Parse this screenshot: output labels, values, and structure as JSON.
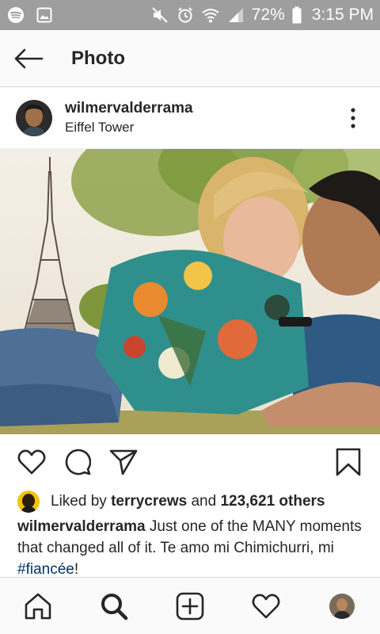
{
  "status_bar": {
    "battery_percent": "72%",
    "time": "3:15 PM",
    "icons": [
      "spotify-icon",
      "gallery-icon",
      "mute-icon",
      "alarm-icon",
      "wifi-icon",
      "signal-icon",
      "battery-icon"
    ]
  },
  "header": {
    "title": "Photo",
    "back_icon": "arrow-left-icon"
  },
  "post": {
    "username": "wilmervalderrama",
    "location": "Eiffel Tower",
    "more_icon": "more-vertical-icon"
  },
  "actions": {
    "icons": [
      "heart-icon",
      "comment-icon",
      "share-icon",
      "bookmark-icon"
    ]
  },
  "likes": {
    "prefix": "Liked by",
    "liker": "terrycrews",
    "joiner": "and",
    "others": "123,621 others"
  },
  "caption": {
    "username": "wilmervalderrama",
    "text": "Just one of the MANY moments that changed all of it.  Te amo mi Chimichurri, mi",
    "hashtag": "#fiancée",
    "suffix": "!"
  },
  "bottom_nav": {
    "items": [
      "home-icon",
      "search-icon",
      "add-post-icon",
      "activity-heart-icon",
      "profile-avatar"
    ]
  },
  "colors": {
    "status_bar_bg": "#9e9e9e",
    "header_bg": "#fafafa",
    "text": "#262626",
    "hashtag": "#003569",
    "divider": "#dbdbdb"
  }
}
